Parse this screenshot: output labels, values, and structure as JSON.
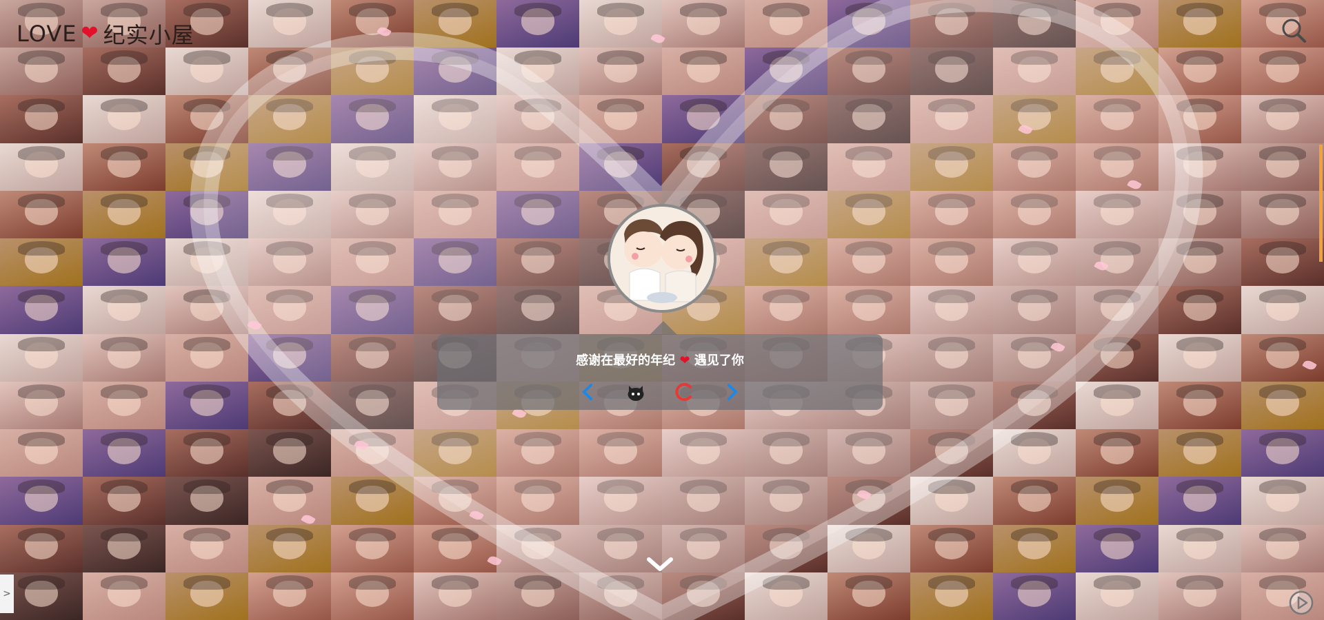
{
  "header": {
    "logo_prefix": "LOVE",
    "logo_suffix": "纪实小屋",
    "search_icon": "search-icon"
  },
  "card": {
    "tagline_before": "感谢在最好的年纪",
    "tagline_after": "遇见了你",
    "controls": [
      "chevron-left-icon",
      "github-icon",
      "loading-spinner-icon",
      "chevron-right-icon"
    ]
  },
  "colors": {
    "heart": "#e3102a",
    "control_blue": "#1e88e5",
    "spinner_red": "#e53935",
    "edge_accent": "#f2a23a"
  },
  "footer": {
    "scroll_icon": "chevron-down-icon",
    "side_tab_label": ">",
    "play_icon": "play-icon"
  }
}
